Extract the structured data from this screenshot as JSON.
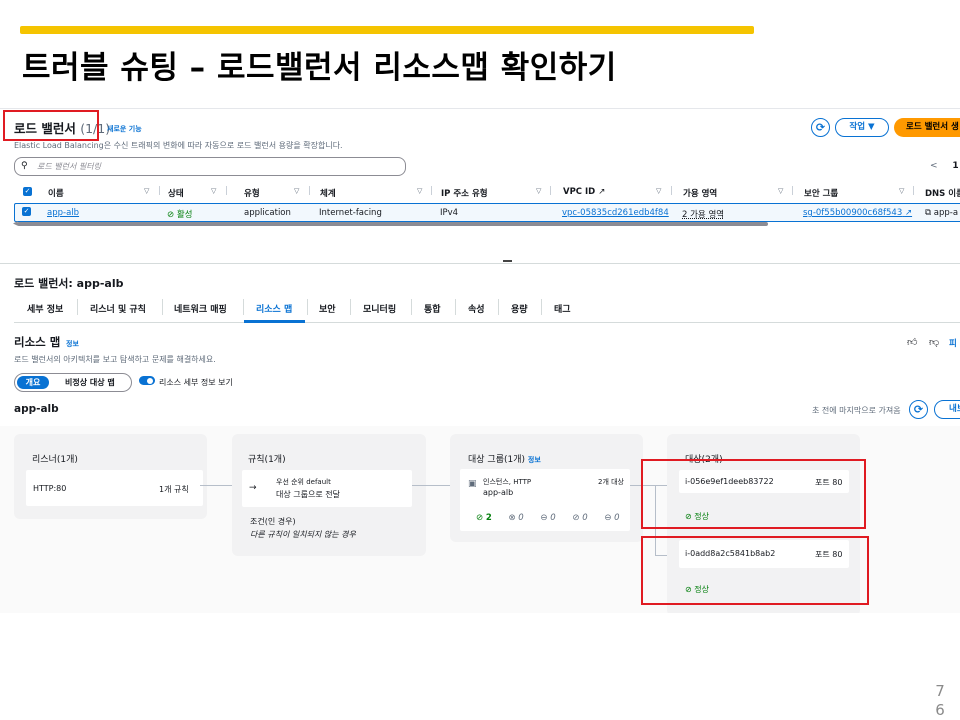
{
  "slide": {
    "title": "트러블 슈팅 – 로드밸런서 리소스맵 확인하기",
    "page_number_1": "7",
    "page_number_2": "6",
    "accent_color": "#f5c400"
  },
  "lb_list": {
    "title": "로드 밸런서",
    "count": "(1/1)",
    "new_feature": "새로운 기능",
    "description": "Elastic Load Balancing은 수신 트래픽의 변화에 따라 자동으로 로드 밸런서 용량을 확장합니다.",
    "actions_label": "작업 ▼",
    "create_label": "로드 밸런서 생",
    "filter_placeholder": "로드 밸런서 필터링",
    "pager_prev": "<",
    "pager_page": "1",
    "columns": [
      "이름",
      "상태",
      "유형",
      "체계",
      "IP 주소 유형",
      "VPC ID",
      "가용 영역",
      "보안 그룹",
      "DNS 이름"
    ],
    "row": {
      "name": "app-alb",
      "state": "활성",
      "type": "application",
      "scheme": "Internet-facing",
      "ip_type": "IPv4",
      "vpc_id": "vpc-05835cd261edb4f84",
      "azs": "2 가용 영역",
      "security_group": "sg-0f55b00900c68f543",
      "dns": "app-a"
    }
  },
  "details": {
    "title": "로드 밸런서: app-alb",
    "tabs": [
      "세부 정보",
      "리스너 및 규칙",
      "네트워크 매핑",
      "리소스 맵",
      "보안",
      "모니터링",
      "통합",
      "속성",
      "용량",
      "태그"
    ],
    "active_tab": "리소스 맵"
  },
  "resource_map": {
    "title": "리소스 맵",
    "info": "정보",
    "description": "로드 밸런서의 아키텍처를 보고 탐색하고 문제를 해결하세요.",
    "feedback_label": "피",
    "seg_overview": "개요",
    "seg_unhealthy": "비정상 대상 맵",
    "toggle_label": "리소스 세부 정보 보기",
    "lb_name": "app-alb",
    "fetched": "초 전에 마지막으로 가져옴",
    "load_label": "내보",
    "listeners": {
      "title": "리스너(1개)",
      "item": "HTTP:80",
      "rules": "1개 규칙"
    },
    "rules": {
      "title": "규칙(1개)",
      "priority": "우선 순위 default",
      "action": "대상 그룹으로 전달",
      "condition_label": "조건(인 경우)",
      "condition_value": "다른 규칙이 일치되지 않는 경우"
    },
    "target_groups": {
      "title": "대상 그룹(1개)",
      "info": "정보",
      "type": "인스턴스, HTTP",
      "name": "app-alb",
      "target_count": "2개 대상",
      "health": [
        "2",
        "0",
        "0",
        "0",
        "0"
      ]
    },
    "targets": {
      "title": "대상(2개)",
      "items": [
        {
          "id": "i-056e9ef1deeb83722",
          "port": "포트 80",
          "status": "정상"
        },
        {
          "id": "i-0add8a2c5841b8ab2",
          "port": "포트 80",
          "status": "정상"
        }
      ]
    }
  },
  "colors": {
    "link": "#0972d3",
    "healthy": "#037f0c",
    "primary_button": "#ff9900",
    "highlight_box": "#e01b22"
  }
}
